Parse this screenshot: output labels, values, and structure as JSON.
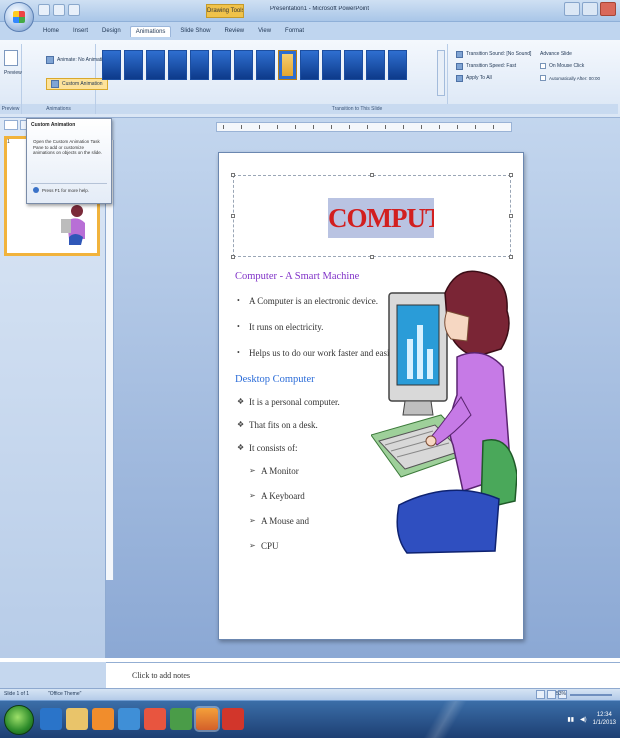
{
  "window": {
    "title": "Presentation1 - Microsoft PowerPoint",
    "context_tab": "Drawing Tools"
  },
  "ribbon": {
    "tabs": [
      "Home",
      "Insert",
      "Design",
      "Animations",
      "Slide Show",
      "Review",
      "View",
      "Format"
    ],
    "active_tab_index": 3,
    "preview_label": "Preview",
    "animate_label": "Animate: No Animation",
    "custom_animation_label": "Custom Animation",
    "group_preview": "Preview",
    "group_animations": "Animations",
    "group_transition": "Transition to This Slide",
    "transition_sound_label": "Transition Sound: [No Sound]",
    "transition_speed_label": "Transition Speed: Fast",
    "apply_all_label": "Apply To All",
    "advance_slide_label": "Advance Slide",
    "on_mouse_click_label": "On Mouse Click",
    "auto_after_label": "Automatically After: 00:00",
    "transition_count": 14,
    "selected_transition_index": 8
  },
  "tooltip": {
    "title": "Custom Animation",
    "body": "Open the Custom Animation Task Pane to add or customize animations on objects on the slide.",
    "help": "Press F1 for more help."
  },
  "slide_pane": {
    "slide_number": "1"
  },
  "slide": {
    "title": "COMPUTER",
    "heading1": "Computer - A Smart Machine",
    "bullets1": [
      "A Computer is an electronic device.",
      "It runs on electricity.",
      "Helps us to do our work faster and easier."
    ],
    "heading2": "Desktop Computer",
    "bullets2": [
      "It is a personal computer.",
      "That fits on a desk.",
      "It consists of:"
    ],
    "sub_bullets": [
      "A Monitor",
      "A Keyboard",
      "A Mouse and",
      "CPU"
    ]
  },
  "notes": {
    "placeholder": "Click to add notes"
  },
  "statusbar": {
    "slide_info": "Slide 1 of 1",
    "theme": "\"Office Theme\"",
    "zoom": "53%"
  },
  "taskbar": {
    "time": "12:34",
    "date": "1/1/2013"
  },
  "colors": {
    "title_red": "#d21f1f",
    "heading_purple": "#8133c8",
    "heading_blue": "#2b6cd8"
  }
}
